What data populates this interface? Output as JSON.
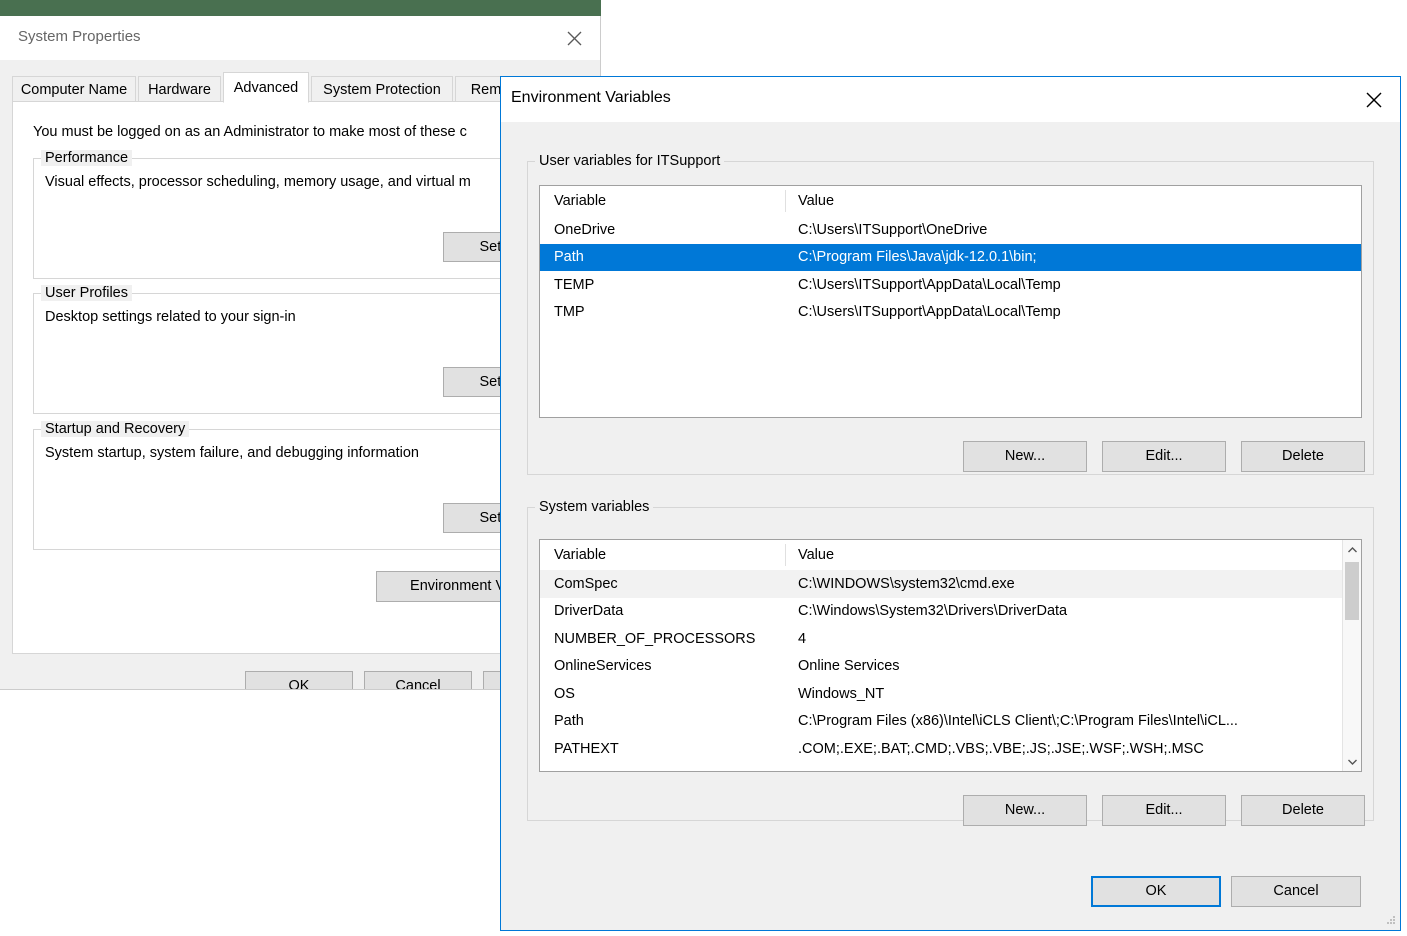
{
  "desktop": {
    "background_color": "#ffffff",
    "accent_color": "#497050"
  },
  "system_properties": {
    "title": "System Properties",
    "close_icon": "close-icon",
    "tabs": [
      {
        "label": "Computer Name",
        "active": false
      },
      {
        "label": "Hardware",
        "active": false
      },
      {
        "label": "Advanced",
        "active": true
      },
      {
        "label": "System Protection",
        "active": false
      },
      {
        "label": "Rem",
        "active": false
      }
    ],
    "admin_note": "You must be logged on as an Administrator to make most of these c",
    "groups": [
      {
        "title": "Performance",
        "description": "Visual effects, processor scheduling, memory usage, and virtual m",
        "button": "Settin"
      },
      {
        "title": "User Profiles",
        "description": "Desktop settings related to your sign-in",
        "button": "Settin"
      },
      {
        "title": "Startup and Recovery",
        "description": "System startup, system failure, and debugging information",
        "button": "Settin"
      }
    ],
    "env_button": "Environment Var",
    "footer": {
      "ok": "OK",
      "cancel": "Cancel",
      "apply": ""
    }
  },
  "environment_variables": {
    "title": "Environment Variables",
    "close_icon": "close-icon",
    "user_section": {
      "group_title": "User variables for ITSupport",
      "columns": [
        "Variable",
        "Value"
      ],
      "rows": [
        {
          "variable": "OneDrive",
          "value": "C:\\Users\\ITSupport\\OneDrive",
          "selected": false
        },
        {
          "variable": "Path",
          "value": "C:\\Program Files\\Java\\jdk-12.0.1\\bin;",
          "selected": true
        },
        {
          "variable": "TEMP",
          "value": "C:\\Users\\ITSupport\\AppData\\Local\\Temp",
          "selected": false
        },
        {
          "variable": "TMP",
          "value": "C:\\Users\\ITSupport\\AppData\\Local\\Temp",
          "selected": false
        }
      ],
      "buttons": {
        "new": "New...",
        "edit": "Edit...",
        "delete": "Delete"
      }
    },
    "system_section": {
      "group_title": "System variables",
      "columns": [
        "Variable",
        "Value"
      ],
      "rows": [
        {
          "variable": "ComSpec",
          "value": "C:\\WINDOWS\\system32\\cmd.exe",
          "hover": true
        },
        {
          "variable": "DriverData",
          "value": "C:\\Windows\\System32\\Drivers\\DriverData",
          "hover": false
        },
        {
          "variable": "NUMBER_OF_PROCESSORS",
          "value": "4",
          "hover": false
        },
        {
          "variable": "OnlineServices",
          "value": "Online Services",
          "hover": false
        },
        {
          "variable": "OS",
          "value": "Windows_NT",
          "hover": false
        },
        {
          "variable": "Path",
          "value": "C:\\Program Files (x86)\\Intel\\iCLS Client\\;C:\\Program Files\\Intel\\iCL...",
          "hover": false
        },
        {
          "variable": "PATHEXT",
          "value": ".COM;.EXE;.BAT;.CMD;.VBS;.VBE;.JS;.JSE;.WSF;.WSH;.MSC",
          "hover": false
        }
      ],
      "buttons": {
        "new": "New...",
        "edit": "Edit...",
        "delete": "Delete"
      },
      "scrollbar": {
        "up_icon": "chevron-up-icon",
        "down_icon": "chevron-down-icon"
      }
    },
    "footer": {
      "ok": "OK",
      "cancel": "Cancel"
    },
    "selection_color": "#0078d7",
    "border_color": "#0078d7"
  }
}
